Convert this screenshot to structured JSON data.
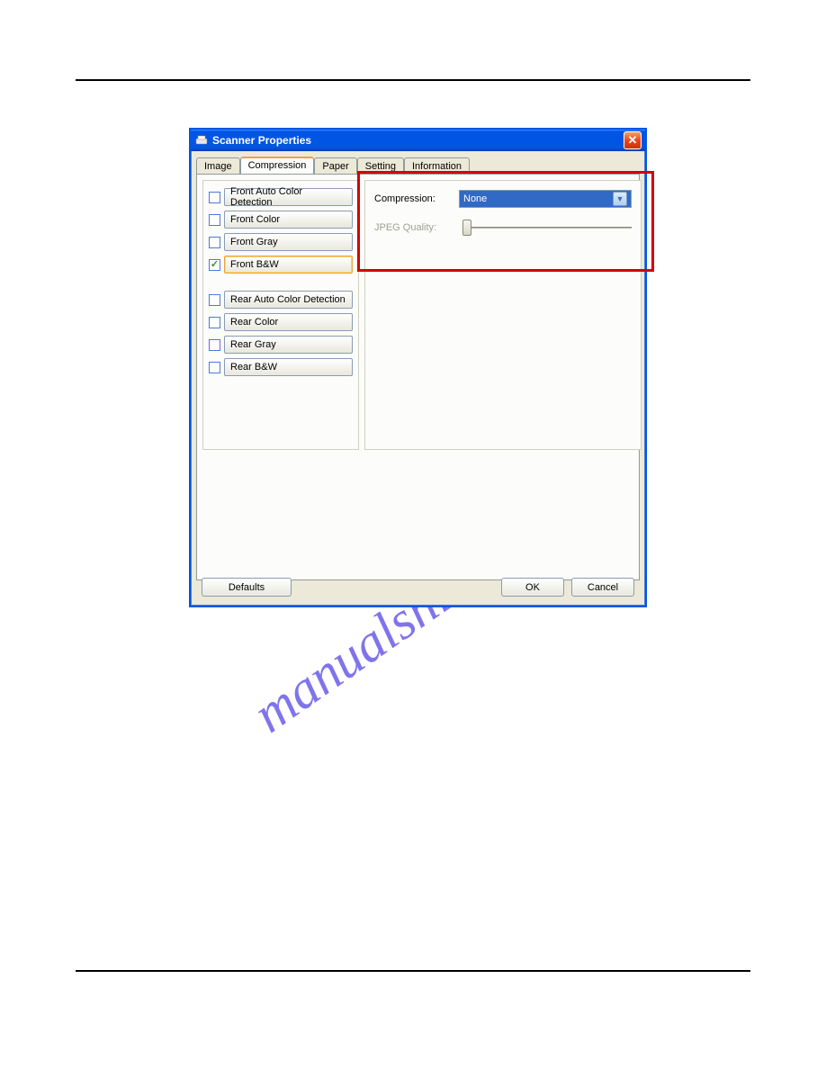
{
  "watermark": "manualshive.com",
  "dialog": {
    "title": "Scanner Properties",
    "tabs": [
      {
        "label": "Image",
        "active": false
      },
      {
        "label": "Compression",
        "active": true
      },
      {
        "label": "Paper",
        "active": false
      },
      {
        "label": "Setting",
        "active": false
      },
      {
        "label": "Information",
        "active": false
      }
    ],
    "front_options": [
      {
        "label": "Front Auto Color Detection",
        "checked": false,
        "selected": false
      },
      {
        "label": "Front Color",
        "checked": false,
        "selected": false
      },
      {
        "label": "Front Gray",
        "checked": false,
        "selected": false
      },
      {
        "label": "Front B&W",
        "checked": true,
        "selected": true
      }
    ],
    "rear_options": [
      {
        "label": "Rear Auto Color Detection",
        "checked": false
      },
      {
        "label": "Rear Color",
        "checked": false
      },
      {
        "label": "Rear Gray",
        "checked": false
      },
      {
        "label": "Rear B&W",
        "checked": false
      }
    ],
    "compression_label": "Compression:",
    "compression_value": "None",
    "jpeg_label": "JPEG Quality:",
    "buttons": {
      "defaults": "Defaults",
      "ok": "OK",
      "cancel": "Cancel"
    }
  }
}
